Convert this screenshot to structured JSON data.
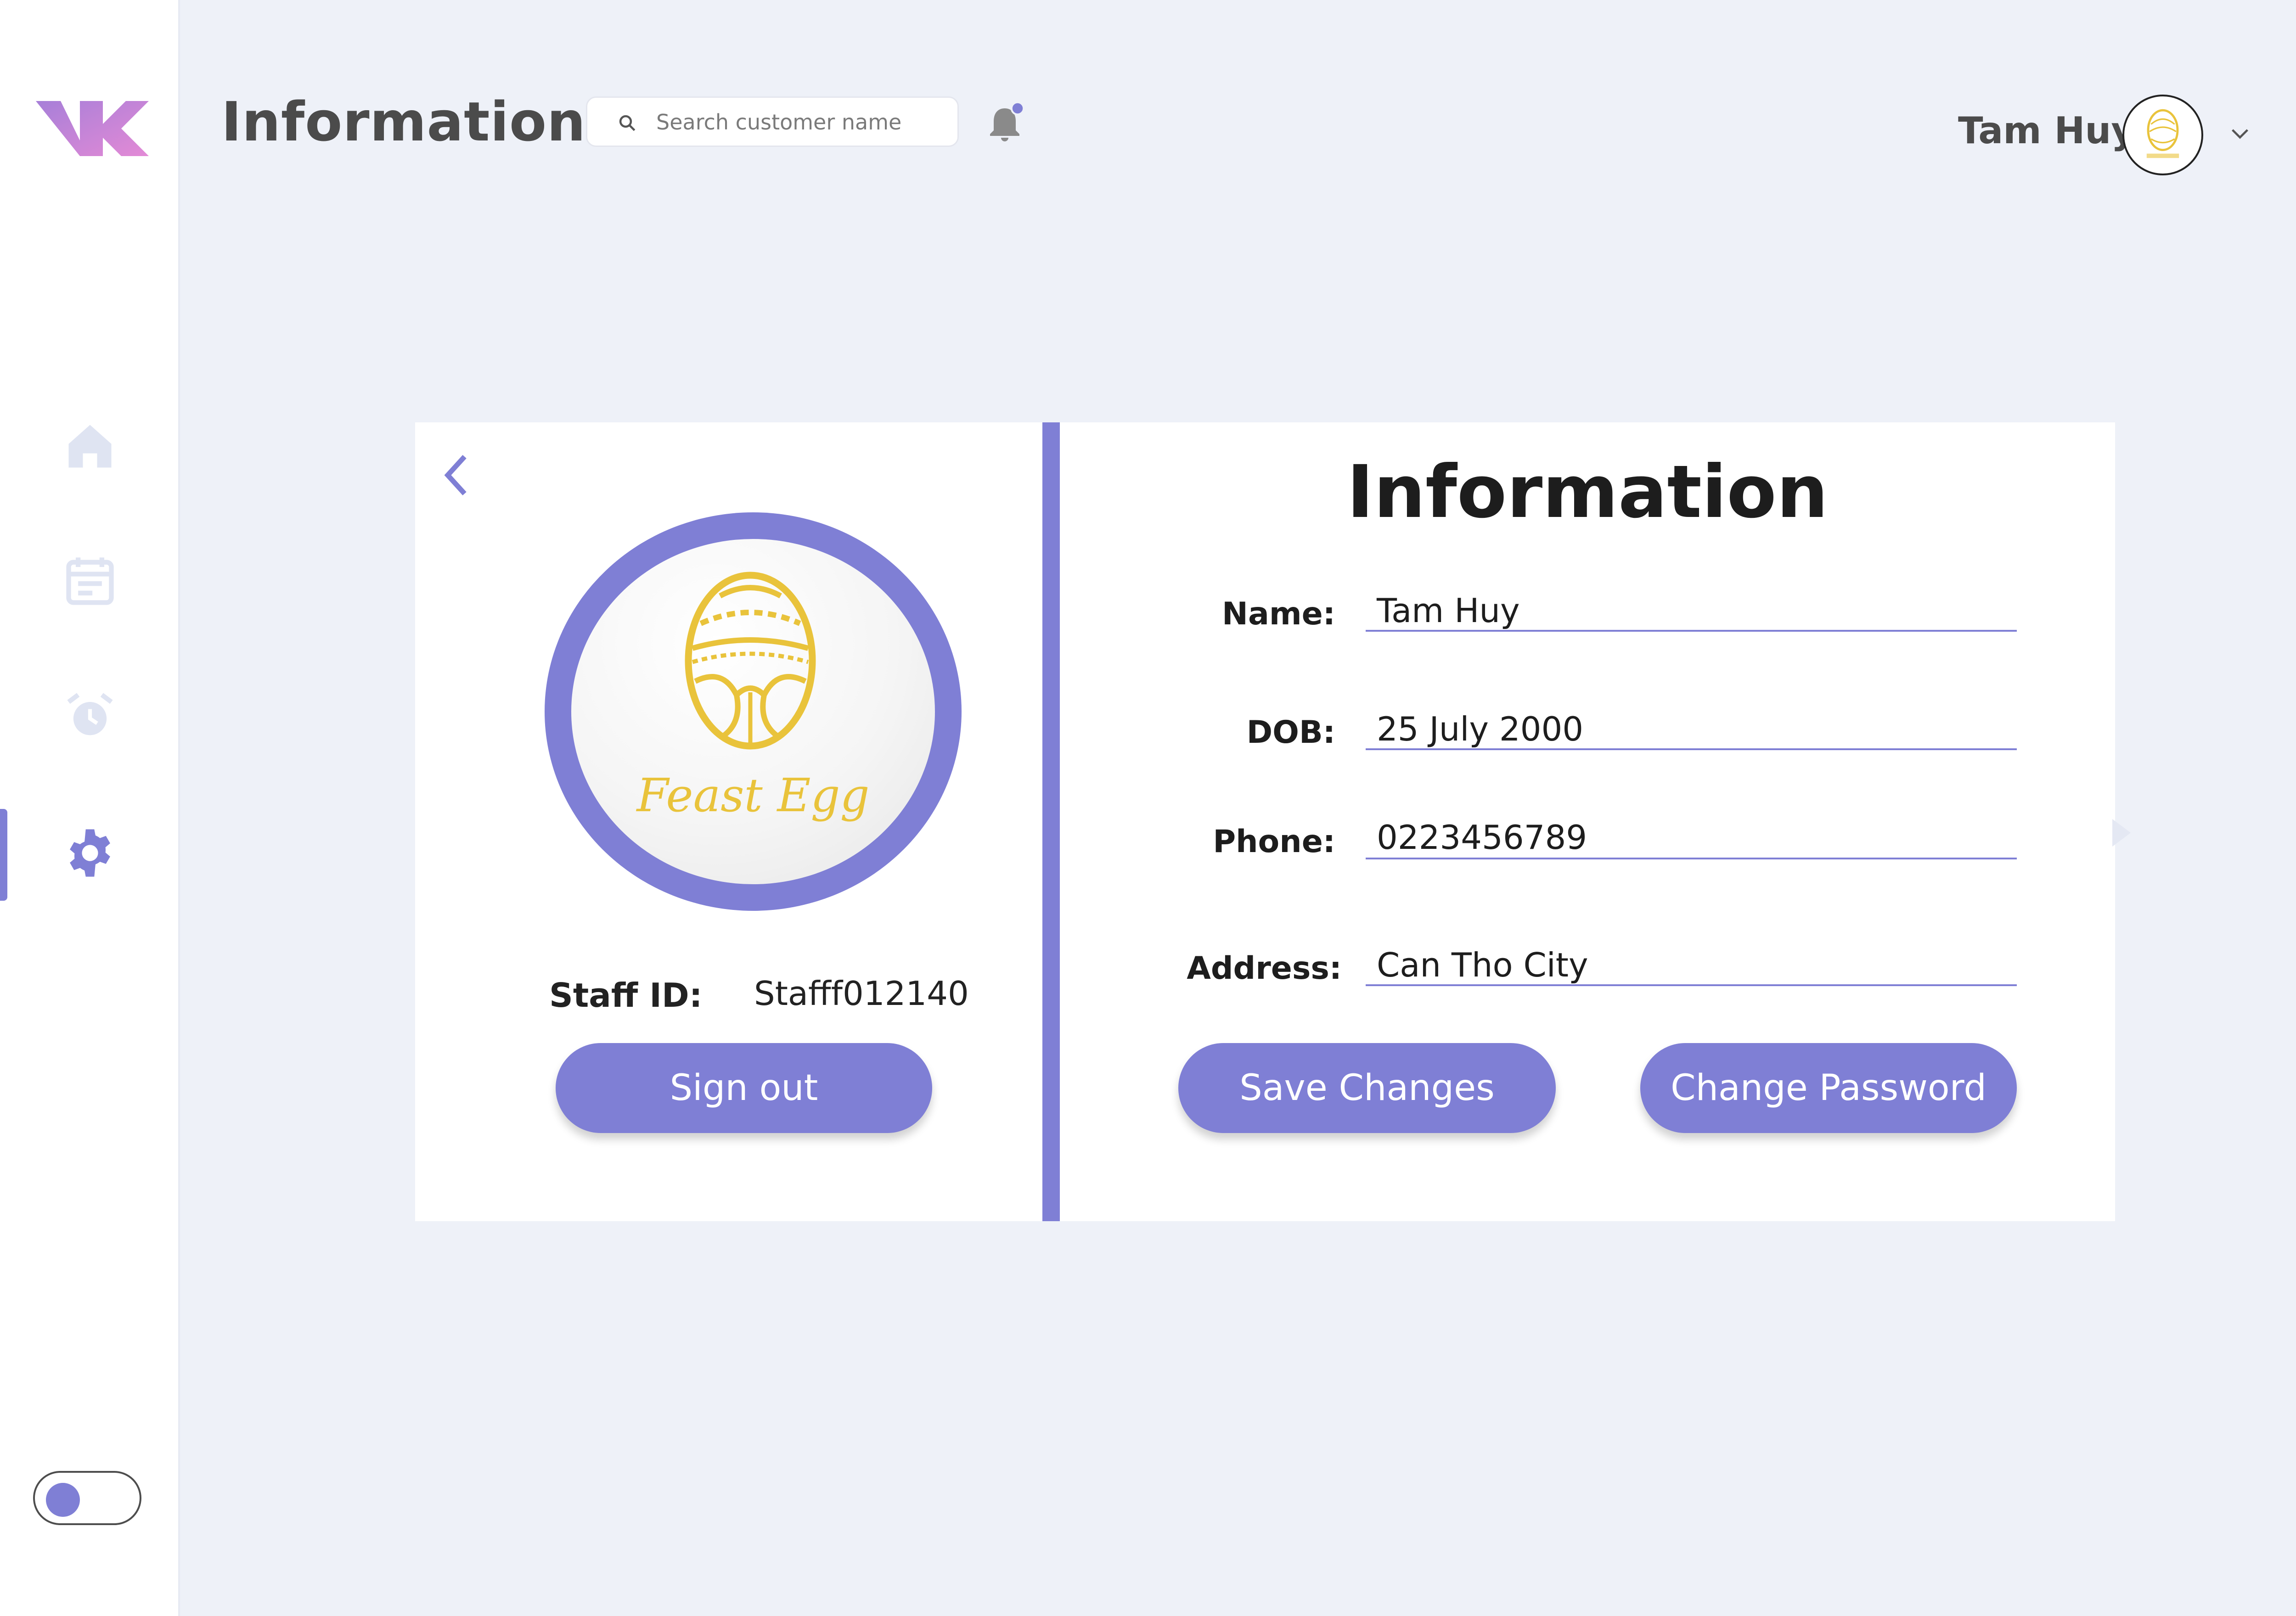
{
  "header": {
    "title": "Information",
    "search": {
      "placeholder": "Search customer name"
    },
    "user_name": "Tam Huy"
  },
  "sidebar": {
    "items": [
      {
        "icon": "home-icon",
        "active": false
      },
      {
        "icon": "calendar-icon",
        "active": false
      },
      {
        "icon": "alarm-clock-icon",
        "active": false
      },
      {
        "icon": "gear-icon",
        "active": true
      }
    ],
    "theme_toggle": "on"
  },
  "profile": {
    "brand": "Feast Egg",
    "staff_id_label": "Staff ID:",
    "staff_id_value": "Stafff012140",
    "signout_label": "Sign out"
  },
  "info": {
    "title": "Information",
    "fields": [
      {
        "label": "Name:",
        "value": "Tam Huy"
      },
      {
        "label": "DOB:",
        "value": "25 July 2000"
      },
      {
        "label": "Phone:",
        "value": "0223456789"
      },
      {
        "label": "Address:",
        "value": "Can Tho City"
      }
    ],
    "save_label": "Save Changes",
    "change_password_label": "Change Password"
  },
  "colors": {
    "accent": "#7f7fd5",
    "background": "#eef1f8",
    "brand_gold": "#e9c33b"
  }
}
